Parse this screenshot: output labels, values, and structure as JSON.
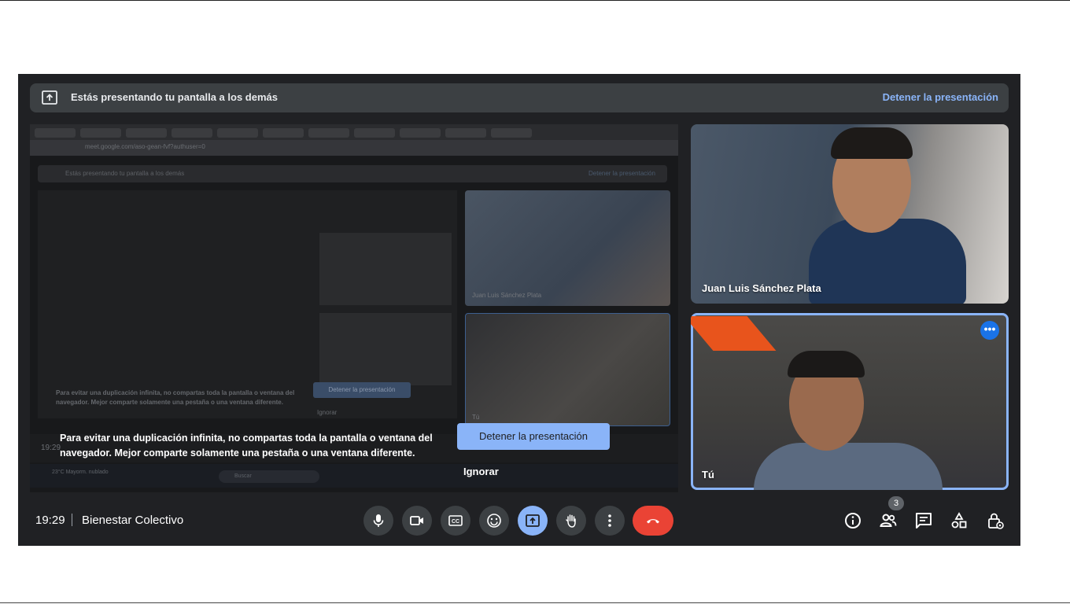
{
  "banner": {
    "text": "Estás presentando tu pantalla a los demás",
    "stop_label": "Detener la presentación"
  },
  "shared_screen": {
    "url": "meet.google.com/aso-gean-fvf?authuser=0",
    "banner_text": "Estás presentando tu pantalla a los demás",
    "banner_stop": "Detener la presentación",
    "tile1_name": "Juan Luis Sánchez Plata",
    "tile2_name": "Tú",
    "message": "Para evitar una duplicación infinita, no compartas toda la pantalla o ventana del navegador. Mejor comparte solamente una pestaña o una ventana diferente.",
    "stop_label": "Detener la presentación",
    "ignore_label": "Ignorar",
    "time": "19:29",
    "meeting": "Bienestar Colectivo",
    "weather": "23°C Mayorm. nublado",
    "search_placeholder": "Buscar"
  },
  "overlay": {
    "message": "Para evitar una duplicación infinita, no compartas toda la pantalla o ventana del navegador. Mejor comparte solamente una pestaña o una ventana diferente.",
    "stop_label": "Detener la presentación",
    "ignore_label": "Ignorar"
  },
  "participants": [
    {
      "name": "Juan Luis Sánchez Plata"
    },
    {
      "name": "Tú"
    }
  ],
  "bottom_bar": {
    "time": "19:29",
    "meeting_name": "Bienestar Colectivo",
    "people_count": "3"
  },
  "colors": {
    "background": "#202124",
    "accent": "#8ab4f8",
    "end_call": "#ea4335",
    "button": "#3c4043"
  },
  "icons": {
    "controls": [
      "mic-icon",
      "camera-icon",
      "captions-icon",
      "emoji-icon",
      "present-icon",
      "raise-hand-icon",
      "more-options-icon",
      "end-call-icon"
    ],
    "right": [
      "info-icon",
      "people-icon",
      "chat-icon",
      "activities-icon",
      "host-controls-icon"
    ]
  }
}
